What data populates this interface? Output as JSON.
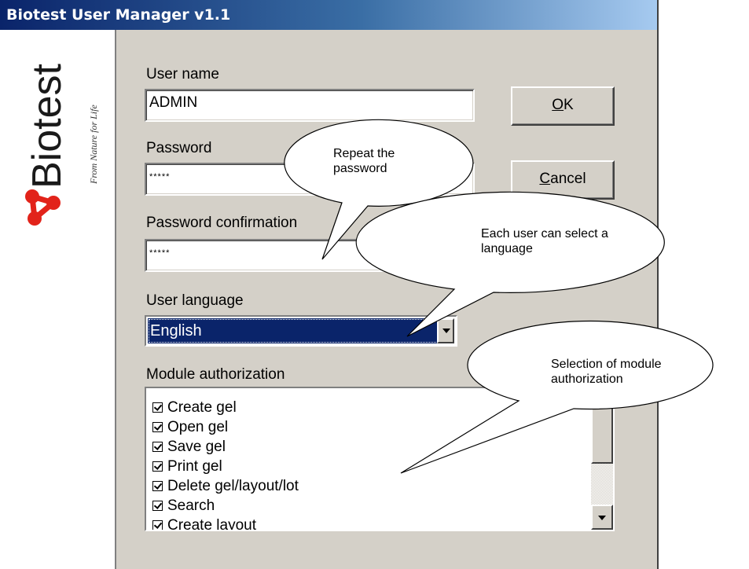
{
  "window": {
    "title": "Biotest User Manager v1.1"
  },
  "logo": {
    "brand": "Biotest",
    "tagline": "From Nature for Life"
  },
  "form": {
    "user_name_label": "User name",
    "user_name_value": "ADMIN",
    "password_label": "Password",
    "password_value": "*****",
    "password_confirm_label": "Password confirmation",
    "password_confirm_value": "*****",
    "language_label": "User language",
    "language_value": "English",
    "module_label": "Module authorization"
  },
  "buttons": {
    "ok_mnemonic": "O",
    "ok_rest": "K",
    "cancel_mnemonic": "C",
    "cancel_rest": "ancel"
  },
  "modules": [
    {
      "label": "Create gel",
      "checked": true
    },
    {
      "label": "Open gel",
      "checked": true
    },
    {
      "label": "Save gel",
      "checked": true
    },
    {
      "label": "Print gel",
      "checked": true
    },
    {
      "label": "Delete gel/layout/lot",
      "checked": true
    },
    {
      "label": "Search",
      "checked": true
    },
    {
      "label": "Create layout",
      "checked": true
    }
  ],
  "callouts": {
    "password": {
      "line1": "Repeat  the",
      "line2": "password"
    },
    "language": {
      "line1": "Each user can select a",
      "line2": "language"
    },
    "modules": {
      "line1": "Selection of module",
      "line2": "authorization"
    }
  },
  "colors": {
    "title_bar": "#0a246a",
    "dialog_face": "#d4d0c8",
    "selection": "#0a246a",
    "logo_mark": "#e2231a"
  }
}
